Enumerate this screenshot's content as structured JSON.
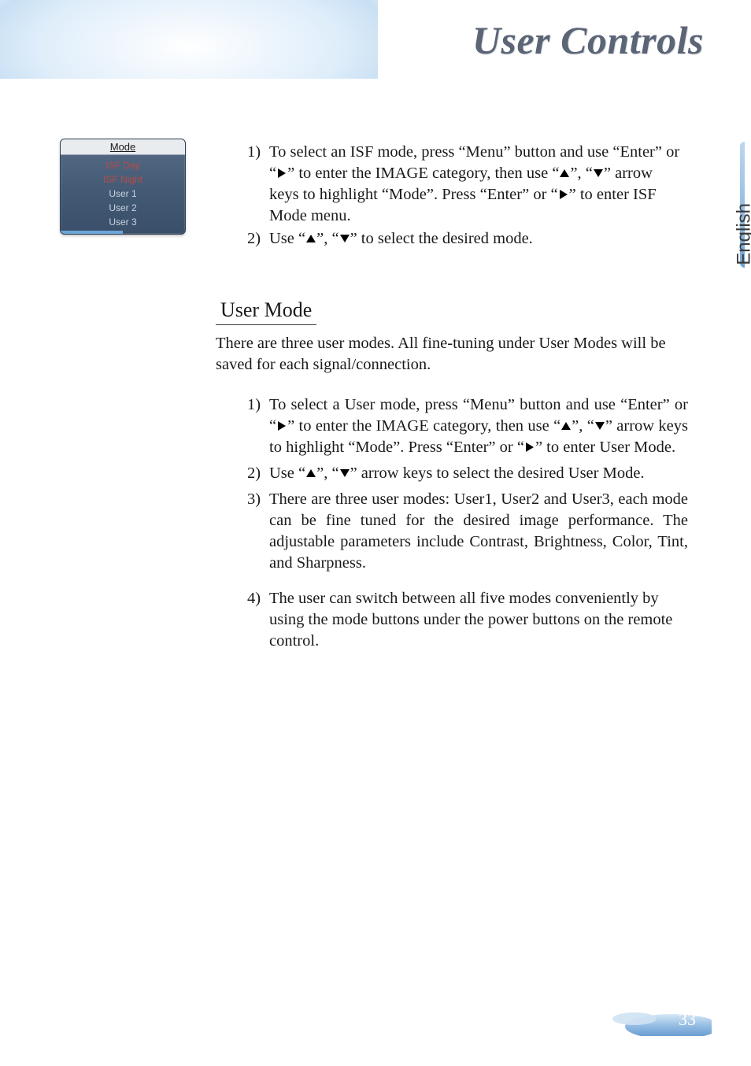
{
  "header": {
    "title": "User Controls"
  },
  "lang_tab": {
    "label": "English"
  },
  "mode_panel": {
    "header": "Mode",
    "items": [
      {
        "label": "ISF Day",
        "kind": "isf"
      },
      {
        "label": "ISF Night",
        "kind": "isf"
      },
      {
        "label": "User 1",
        "kind": "user"
      },
      {
        "label": "User 2",
        "kind": "user"
      },
      {
        "label": "User 3",
        "kind": "user"
      }
    ]
  },
  "isf_steps": {
    "1": {
      "num": "1)",
      "a": "To select an ISF mode, press “Menu” button and use “Enter” or “",
      "b": "” to enter the IMAGE category, then use “",
      "c": "”, “",
      "d": "” arrow keys to highlight “Mode”. Press “Enter” or “",
      "e": "” to enter ISF Mode menu."
    },
    "2": {
      "num": "2)",
      "a": "Use “",
      "b": "”, “",
      "c": "” to select the desired mode."
    }
  },
  "user_mode": {
    "heading": "User Mode",
    "intro": "There are three user modes. All fine-tuning under User Modes will be saved for each signal/connection.",
    "steps": {
      "1": {
        "num": "1)",
        "a": "To select a User mode, press “Menu” button and use “Enter” or “",
        "b": "” to enter the IMAGE category, then use “",
        "c": "”, “",
        "d": "” arrow keys to highlight “Mode”. Press “Enter” or “",
        "e": "” to enter User Mode."
      },
      "2": {
        "num": "2)",
        "a": "Use “",
        "b": "”, “",
        "c": "” arrow keys to select the desired User Mode."
      },
      "3": {
        "num": "3)",
        "text": "There are three user modes: User1, User2 and User3, each mode can be fine tuned for the desired image performance. The adjustable parameters include Contrast, Brightness, Color, Tint, and Sharpness."
      },
      "4": {
        "num": "4)",
        "text": "The user can switch between all five modes conveniently by using the mode buttons under the power buttons on the remote control."
      }
    }
  },
  "footer": {
    "page_number": "33"
  }
}
